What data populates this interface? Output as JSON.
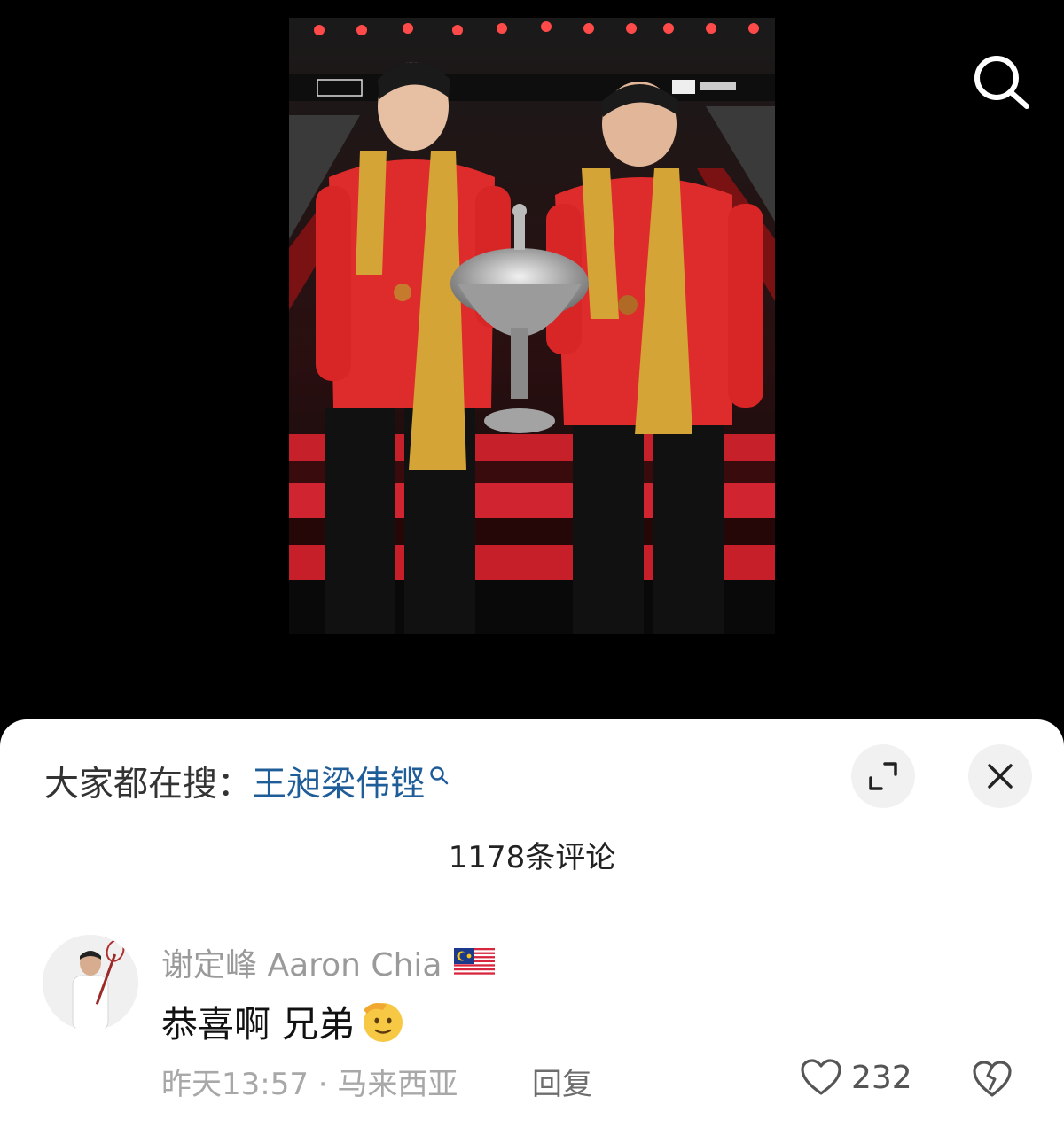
{
  "photo": {
    "description": "Two badminton players in red jackets and gold scarves holding a silver trophy on stage"
  },
  "top_bar": {
    "search_icon": "search-icon"
  },
  "sheet": {
    "suggest_prefix": "大家都在搜：",
    "suggest_term": "王昶梁伟铿",
    "comment_count": "1178条评论",
    "buttons": {
      "expand_icon": "expand-icon",
      "close_icon": "close-icon"
    }
  },
  "comment": {
    "author": "谢定峰 Aaron Chia",
    "flag": "malaysia-flag-icon",
    "text": "恭喜啊 兄弟",
    "emoji": "salute-emoji",
    "meta": "昨天13:57 · 马来西亚",
    "reply_label": "回复",
    "likes": "232",
    "colors": {
      "author": "#9a9a9a",
      "link": "#1f5d99"
    }
  }
}
